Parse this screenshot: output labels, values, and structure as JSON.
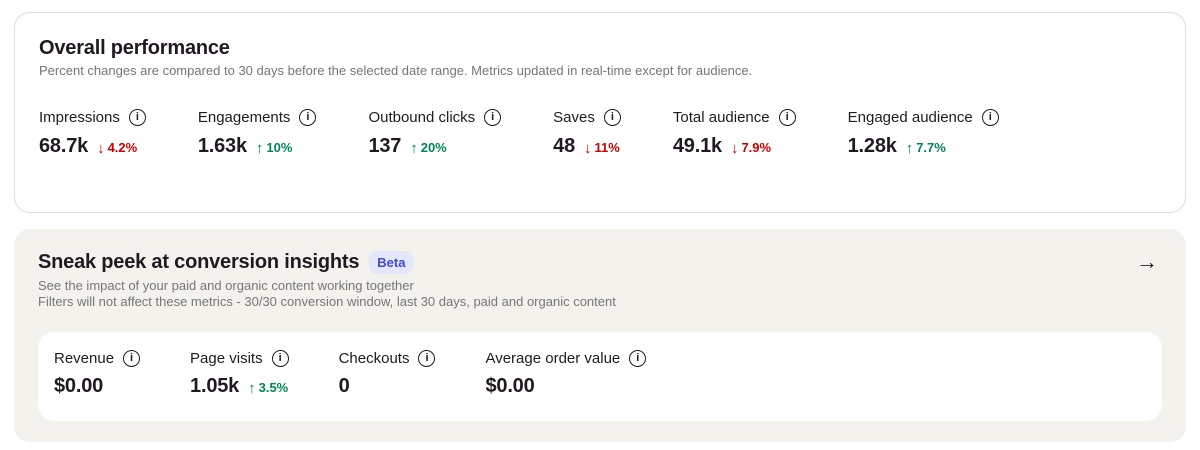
{
  "colors": {
    "positive_green": "#008753",
    "negative_red": "#cc0000",
    "beta_text_blue": "#3d4bd1",
    "beta_bg_lavender": "#e4e6fb",
    "subtitle_gray": "#767676",
    "section_bg_beige": "#f3f2ec",
    "card_border": "#e0ded7",
    "text_dark": "#211922"
  },
  "icons": {
    "info_glyph": "i",
    "up_arrow": "↑",
    "down_arrow": "↓",
    "forward_arrow": "→"
  },
  "overall_card": {
    "title": "Overall performance",
    "subtitle": "Percent changes are compared to 30 days before the selected date range. Metrics updated in real-time except for audience.",
    "info_icon_glyph": "i",
    "metrics": [
      {
        "label": "Impressions",
        "value": "68.7k",
        "trend": "down",
        "arrow": "↓",
        "change": "4.2%"
      },
      {
        "label": "Engagements",
        "value": "1.63k",
        "trend": "up",
        "arrow": "↑",
        "change": "10%"
      },
      {
        "label": "Outbound clicks",
        "value": "137",
        "trend": "up",
        "arrow": "↑",
        "change": "20%"
      },
      {
        "label": "Saves",
        "value": "48",
        "trend": "down",
        "arrow": "↓",
        "change": "11%"
      },
      {
        "label": "Total audience",
        "value": "49.1k",
        "trend": "down",
        "arrow": "↓",
        "change": "7.9%"
      },
      {
        "label": "Engaged audience",
        "value": "1.28k",
        "trend": "up",
        "arrow": "↑",
        "change": "7.7%"
      }
    ]
  },
  "conversion_card": {
    "title": "Sneak peek at conversion insights",
    "beta_badge": "Beta",
    "subtitle_line1": "See the impact of your paid and organic content working together",
    "subtitle_line2": "Filters will not affect these metrics - 30/30 conversion window, last 30 days, paid and organic content",
    "forward_arrow_glyph": "→",
    "info_icon_glyph": "i",
    "metrics": [
      {
        "label": "Revenue",
        "value": "$0.00",
        "trend": "none",
        "arrow": "",
        "change": ""
      },
      {
        "label": "Page visits",
        "value": "1.05k",
        "trend": "up",
        "arrow": "↑",
        "change": "3.5%"
      },
      {
        "label": "Checkouts",
        "value": "0",
        "trend": "none",
        "arrow": "",
        "change": ""
      },
      {
        "label": "Average order value",
        "value": "$0.00",
        "trend": "none",
        "arrow": "",
        "change": ""
      }
    ]
  }
}
